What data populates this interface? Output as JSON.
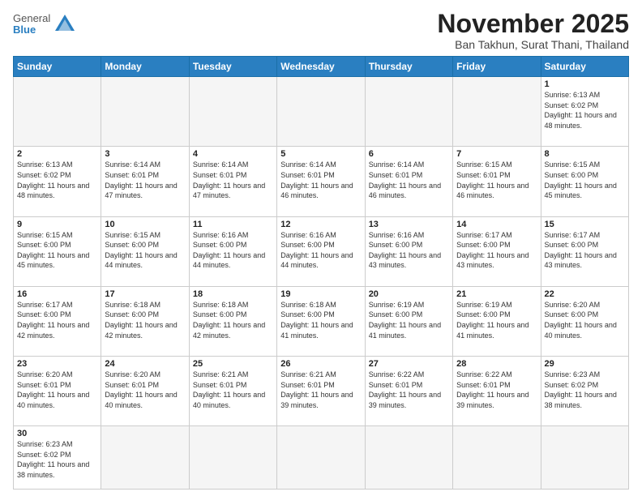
{
  "header": {
    "logo_general": "General",
    "logo_blue": "Blue",
    "month_title": "November 2025",
    "location": "Ban Takhun, Surat Thani, Thailand"
  },
  "days_of_week": [
    "Sunday",
    "Monday",
    "Tuesday",
    "Wednesday",
    "Thursday",
    "Friday",
    "Saturday"
  ],
  "weeks": [
    [
      {
        "day": "",
        "info": ""
      },
      {
        "day": "",
        "info": ""
      },
      {
        "day": "",
        "info": ""
      },
      {
        "day": "",
        "info": ""
      },
      {
        "day": "",
        "info": ""
      },
      {
        "day": "",
        "info": ""
      },
      {
        "day": "1",
        "info": "Sunrise: 6:13 AM\nSunset: 6:02 PM\nDaylight: 11 hours and 48 minutes."
      }
    ],
    [
      {
        "day": "2",
        "info": "Sunrise: 6:13 AM\nSunset: 6:02 PM\nDaylight: 11 hours and 48 minutes."
      },
      {
        "day": "3",
        "info": "Sunrise: 6:14 AM\nSunset: 6:01 PM\nDaylight: 11 hours and 47 minutes."
      },
      {
        "day": "4",
        "info": "Sunrise: 6:14 AM\nSunset: 6:01 PM\nDaylight: 11 hours and 47 minutes."
      },
      {
        "day": "5",
        "info": "Sunrise: 6:14 AM\nSunset: 6:01 PM\nDaylight: 11 hours and 46 minutes."
      },
      {
        "day": "6",
        "info": "Sunrise: 6:14 AM\nSunset: 6:01 PM\nDaylight: 11 hours and 46 minutes."
      },
      {
        "day": "7",
        "info": "Sunrise: 6:15 AM\nSunset: 6:01 PM\nDaylight: 11 hours and 46 minutes."
      },
      {
        "day": "8",
        "info": "Sunrise: 6:15 AM\nSunset: 6:00 PM\nDaylight: 11 hours and 45 minutes."
      }
    ],
    [
      {
        "day": "9",
        "info": "Sunrise: 6:15 AM\nSunset: 6:00 PM\nDaylight: 11 hours and 45 minutes."
      },
      {
        "day": "10",
        "info": "Sunrise: 6:15 AM\nSunset: 6:00 PM\nDaylight: 11 hours and 44 minutes."
      },
      {
        "day": "11",
        "info": "Sunrise: 6:16 AM\nSunset: 6:00 PM\nDaylight: 11 hours and 44 minutes."
      },
      {
        "day": "12",
        "info": "Sunrise: 6:16 AM\nSunset: 6:00 PM\nDaylight: 11 hours and 44 minutes."
      },
      {
        "day": "13",
        "info": "Sunrise: 6:16 AM\nSunset: 6:00 PM\nDaylight: 11 hours and 43 minutes."
      },
      {
        "day": "14",
        "info": "Sunrise: 6:17 AM\nSunset: 6:00 PM\nDaylight: 11 hours and 43 minutes."
      },
      {
        "day": "15",
        "info": "Sunrise: 6:17 AM\nSunset: 6:00 PM\nDaylight: 11 hours and 43 minutes."
      }
    ],
    [
      {
        "day": "16",
        "info": "Sunrise: 6:17 AM\nSunset: 6:00 PM\nDaylight: 11 hours and 42 minutes."
      },
      {
        "day": "17",
        "info": "Sunrise: 6:18 AM\nSunset: 6:00 PM\nDaylight: 11 hours and 42 minutes."
      },
      {
        "day": "18",
        "info": "Sunrise: 6:18 AM\nSunset: 6:00 PM\nDaylight: 11 hours and 42 minutes."
      },
      {
        "day": "19",
        "info": "Sunrise: 6:18 AM\nSunset: 6:00 PM\nDaylight: 11 hours and 41 minutes."
      },
      {
        "day": "20",
        "info": "Sunrise: 6:19 AM\nSunset: 6:00 PM\nDaylight: 11 hours and 41 minutes."
      },
      {
        "day": "21",
        "info": "Sunrise: 6:19 AM\nSunset: 6:00 PM\nDaylight: 11 hours and 41 minutes."
      },
      {
        "day": "22",
        "info": "Sunrise: 6:20 AM\nSunset: 6:00 PM\nDaylight: 11 hours and 40 minutes."
      }
    ],
    [
      {
        "day": "23",
        "info": "Sunrise: 6:20 AM\nSunset: 6:01 PM\nDaylight: 11 hours and 40 minutes."
      },
      {
        "day": "24",
        "info": "Sunrise: 6:20 AM\nSunset: 6:01 PM\nDaylight: 11 hours and 40 minutes."
      },
      {
        "day": "25",
        "info": "Sunrise: 6:21 AM\nSunset: 6:01 PM\nDaylight: 11 hours and 40 minutes."
      },
      {
        "day": "26",
        "info": "Sunrise: 6:21 AM\nSunset: 6:01 PM\nDaylight: 11 hours and 39 minutes."
      },
      {
        "day": "27",
        "info": "Sunrise: 6:22 AM\nSunset: 6:01 PM\nDaylight: 11 hours and 39 minutes."
      },
      {
        "day": "28",
        "info": "Sunrise: 6:22 AM\nSunset: 6:01 PM\nDaylight: 11 hours and 39 minutes."
      },
      {
        "day": "29",
        "info": "Sunrise: 6:23 AM\nSunset: 6:02 PM\nDaylight: 11 hours and 38 minutes."
      }
    ],
    [
      {
        "day": "30",
        "info": "Sunrise: 6:23 AM\nSunset: 6:02 PM\nDaylight: 11 hours and 38 minutes."
      },
      {
        "day": "",
        "info": ""
      },
      {
        "day": "",
        "info": ""
      },
      {
        "day": "",
        "info": ""
      },
      {
        "day": "",
        "info": ""
      },
      {
        "day": "",
        "info": ""
      },
      {
        "day": "",
        "info": ""
      }
    ]
  ]
}
